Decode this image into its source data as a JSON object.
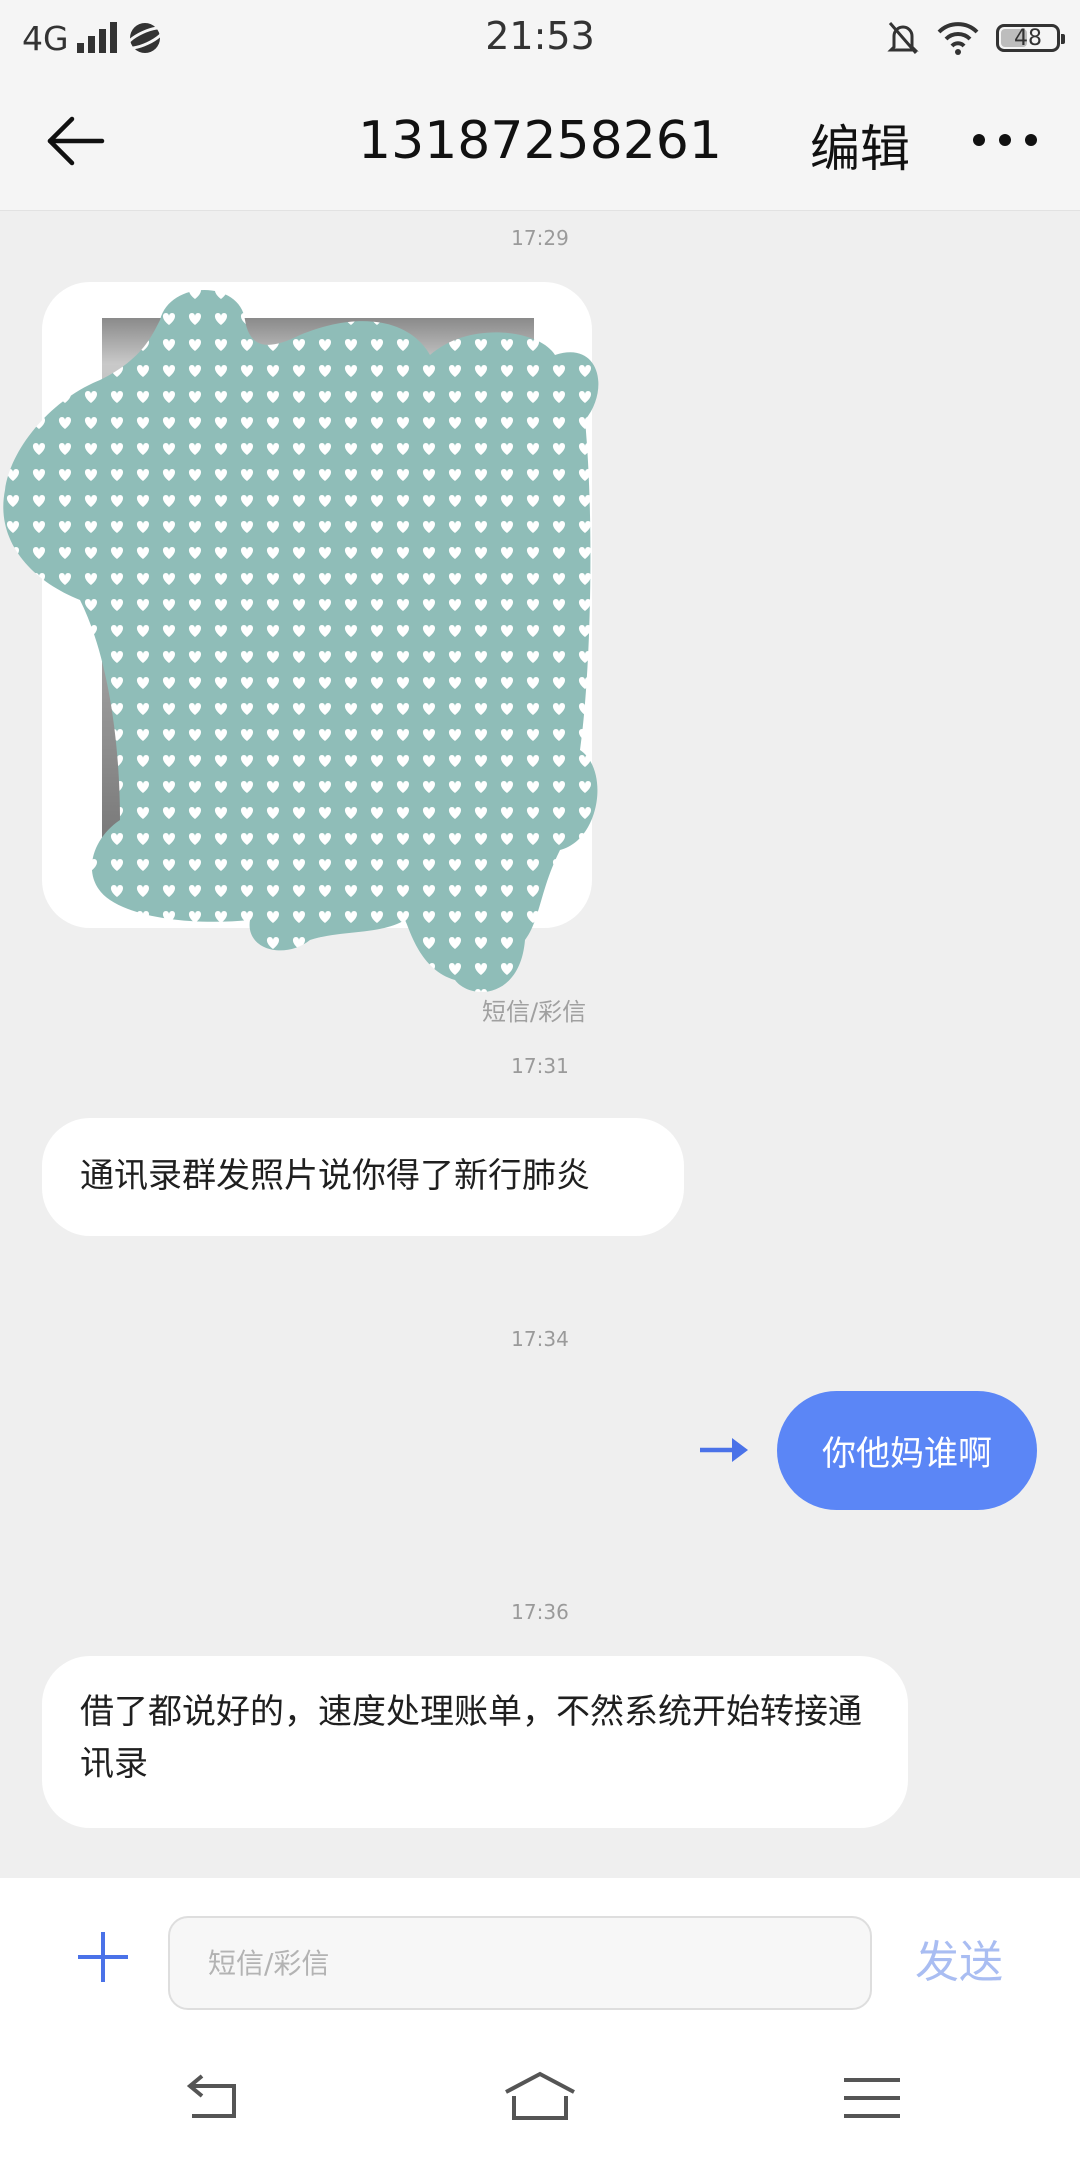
{
  "status_bar": {
    "network": "4G",
    "time": "21:53",
    "battery": "48",
    "battery_level": 0.48
  },
  "header": {
    "title": "13187258261",
    "edit_label": "编辑"
  },
  "messages": [
    {
      "timestamp": "17:29",
      "type_label": "短信/彩信"
    },
    {
      "timestamp": "17:31",
      "text": "通讯录群发照片说你得了新行肺炎"
    },
    {
      "timestamp": "17:34",
      "text": "你他妈谁啊"
    },
    {
      "timestamp": "17:36",
      "text": "借了都说好的，速度处理账单，不然系统开始转接通讯录"
    }
  ],
  "composer": {
    "placeholder": "短信/彩信",
    "send_label": "发送"
  },
  "colors": {
    "accent": "#5b86f6",
    "send_disabled": "#a9bdf2",
    "mask": "#8fbdb8"
  }
}
